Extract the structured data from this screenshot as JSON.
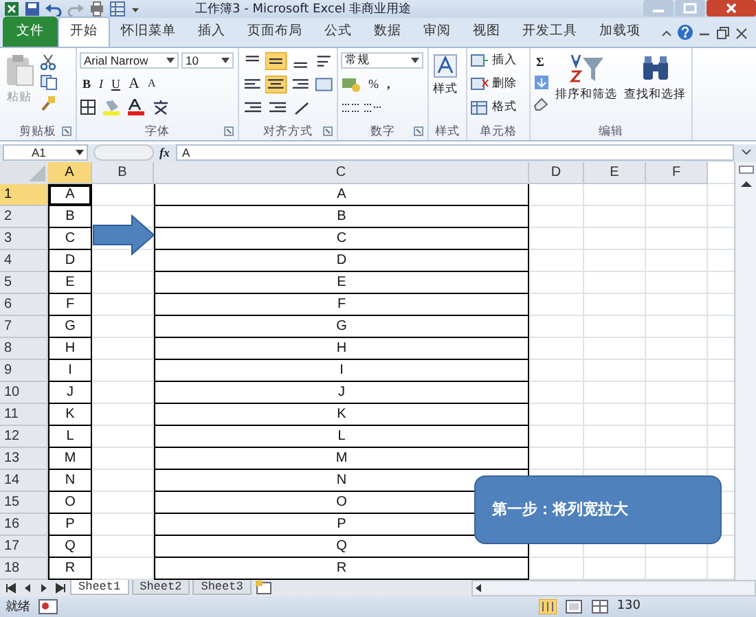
{
  "window": {
    "title": "工作簿3 - Microsoft Excel 非商业用途"
  },
  "tabs": [
    {
      "label": "文件",
      "kind": "file",
      "selected": false
    },
    {
      "label": "开始",
      "kind": "tab",
      "selected": true
    },
    {
      "label": "怀旧菜单",
      "kind": "tab",
      "selected": false
    },
    {
      "label": "插入",
      "kind": "tab",
      "selected": false
    },
    {
      "label": "页面布局",
      "kind": "tab",
      "selected": false
    },
    {
      "label": "公式",
      "kind": "tab",
      "selected": false
    },
    {
      "label": "数据",
      "kind": "tab",
      "selected": false
    },
    {
      "label": "审阅",
      "kind": "tab",
      "selected": false
    },
    {
      "label": "视图",
      "kind": "tab",
      "selected": false
    },
    {
      "label": "开发工具",
      "kind": "tab",
      "selected": false
    },
    {
      "label": "加载项",
      "kind": "tab",
      "selected": false
    }
  ],
  "ribbon": {
    "clipboard": {
      "label": "剪贴板",
      "paste": "粘贴"
    },
    "font": {
      "label": "字体",
      "font_name": "Arial Narrow",
      "font_size": "10",
      "bold": "B",
      "italic": "I",
      "underline": "U",
      "grow": "A",
      "shrink": "A"
    },
    "alignment": {
      "label": "对齐方式"
    },
    "number": {
      "label": "数字",
      "format": "常规",
      "percent": "%",
      "comma": ","
    },
    "styles": {
      "label": "样式",
      "button": "样式"
    },
    "cells": {
      "label": "单元格",
      "insert": "插入",
      "delete": "删除",
      "format": "格式"
    },
    "editing": {
      "label": "编辑",
      "sum": "Σ",
      "sort": "排序和筛选",
      "find": "查找和选择"
    }
  },
  "formula_bar": {
    "name_box": "A1",
    "fx": "fx",
    "value": "A"
  },
  "columns": [
    {
      "label": "A",
      "selected": true,
      "bordered": true
    },
    {
      "label": "B",
      "selected": false,
      "bordered": false
    },
    {
      "label": "C",
      "selected": false,
      "bordered": true
    },
    {
      "label": "D",
      "selected": false,
      "bordered": false
    },
    {
      "label": "E",
      "selected": false,
      "bordered": false
    },
    {
      "label": "F",
      "selected": false,
      "bordered": false
    }
  ],
  "rows": [
    {
      "number": "1",
      "selected": true,
      "cells": [
        "A",
        "",
        "A",
        "",
        "",
        ""
      ]
    },
    {
      "number": "2",
      "selected": false,
      "cells": [
        "B",
        "",
        "B",
        "",
        "",
        ""
      ]
    },
    {
      "number": "3",
      "selected": false,
      "cells": [
        "C",
        "",
        "C",
        "",
        "",
        ""
      ]
    },
    {
      "number": "4",
      "selected": false,
      "cells": [
        "D",
        "",
        "D",
        "",
        "",
        ""
      ]
    },
    {
      "number": "5",
      "selected": false,
      "cells": [
        "E",
        "",
        "E",
        "",
        "",
        ""
      ]
    },
    {
      "number": "6",
      "selected": false,
      "cells": [
        "F",
        "",
        "F",
        "",
        "",
        ""
      ]
    },
    {
      "number": "7",
      "selected": false,
      "cells": [
        "G",
        "",
        "G",
        "",
        "",
        ""
      ]
    },
    {
      "number": "8",
      "selected": false,
      "cells": [
        "H",
        "",
        "H",
        "",
        "",
        ""
      ]
    },
    {
      "number": "9",
      "selected": false,
      "cells": [
        "I",
        "",
        "I",
        "",
        "",
        ""
      ]
    },
    {
      "number": "10",
      "selected": false,
      "cells": [
        "J",
        "",
        "J",
        "",
        "",
        ""
      ]
    },
    {
      "number": "11",
      "selected": false,
      "cells": [
        "K",
        "",
        "K",
        "",
        "",
        ""
      ]
    },
    {
      "number": "12",
      "selected": false,
      "cells": [
        "L",
        "",
        "L",
        "",
        "",
        ""
      ]
    },
    {
      "number": "13",
      "selected": false,
      "cells": [
        "M",
        "",
        "M",
        "",
        "",
        ""
      ]
    },
    {
      "number": "14",
      "selected": false,
      "cells": [
        "N",
        "",
        "N",
        "",
        "",
        ""
      ]
    },
    {
      "number": "15",
      "selected": false,
      "cells": [
        "O",
        "",
        "O",
        "",
        "",
        ""
      ]
    },
    {
      "number": "16",
      "selected": false,
      "cells": [
        "P",
        "",
        "P",
        "",
        "",
        ""
      ]
    },
    {
      "number": "17",
      "selected": false,
      "cells": [
        "Q",
        "",
        "Q",
        "",
        "",
        ""
      ]
    },
    {
      "number": "18",
      "selected": false,
      "cells": [
        "R",
        "",
        "R",
        "",
        "",
        ""
      ]
    }
  ],
  "sheets": [
    {
      "label": "Sheet1",
      "selected": true
    },
    {
      "label": "Sheet2",
      "selected": false
    },
    {
      "label": "Sheet3",
      "selected": false
    }
  ],
  "status_bar": {
    "status": "就绪",
    "zoom": "130"
  },
  "callout": {
    "text": "第一步：将列宽拉大"
  }
}
